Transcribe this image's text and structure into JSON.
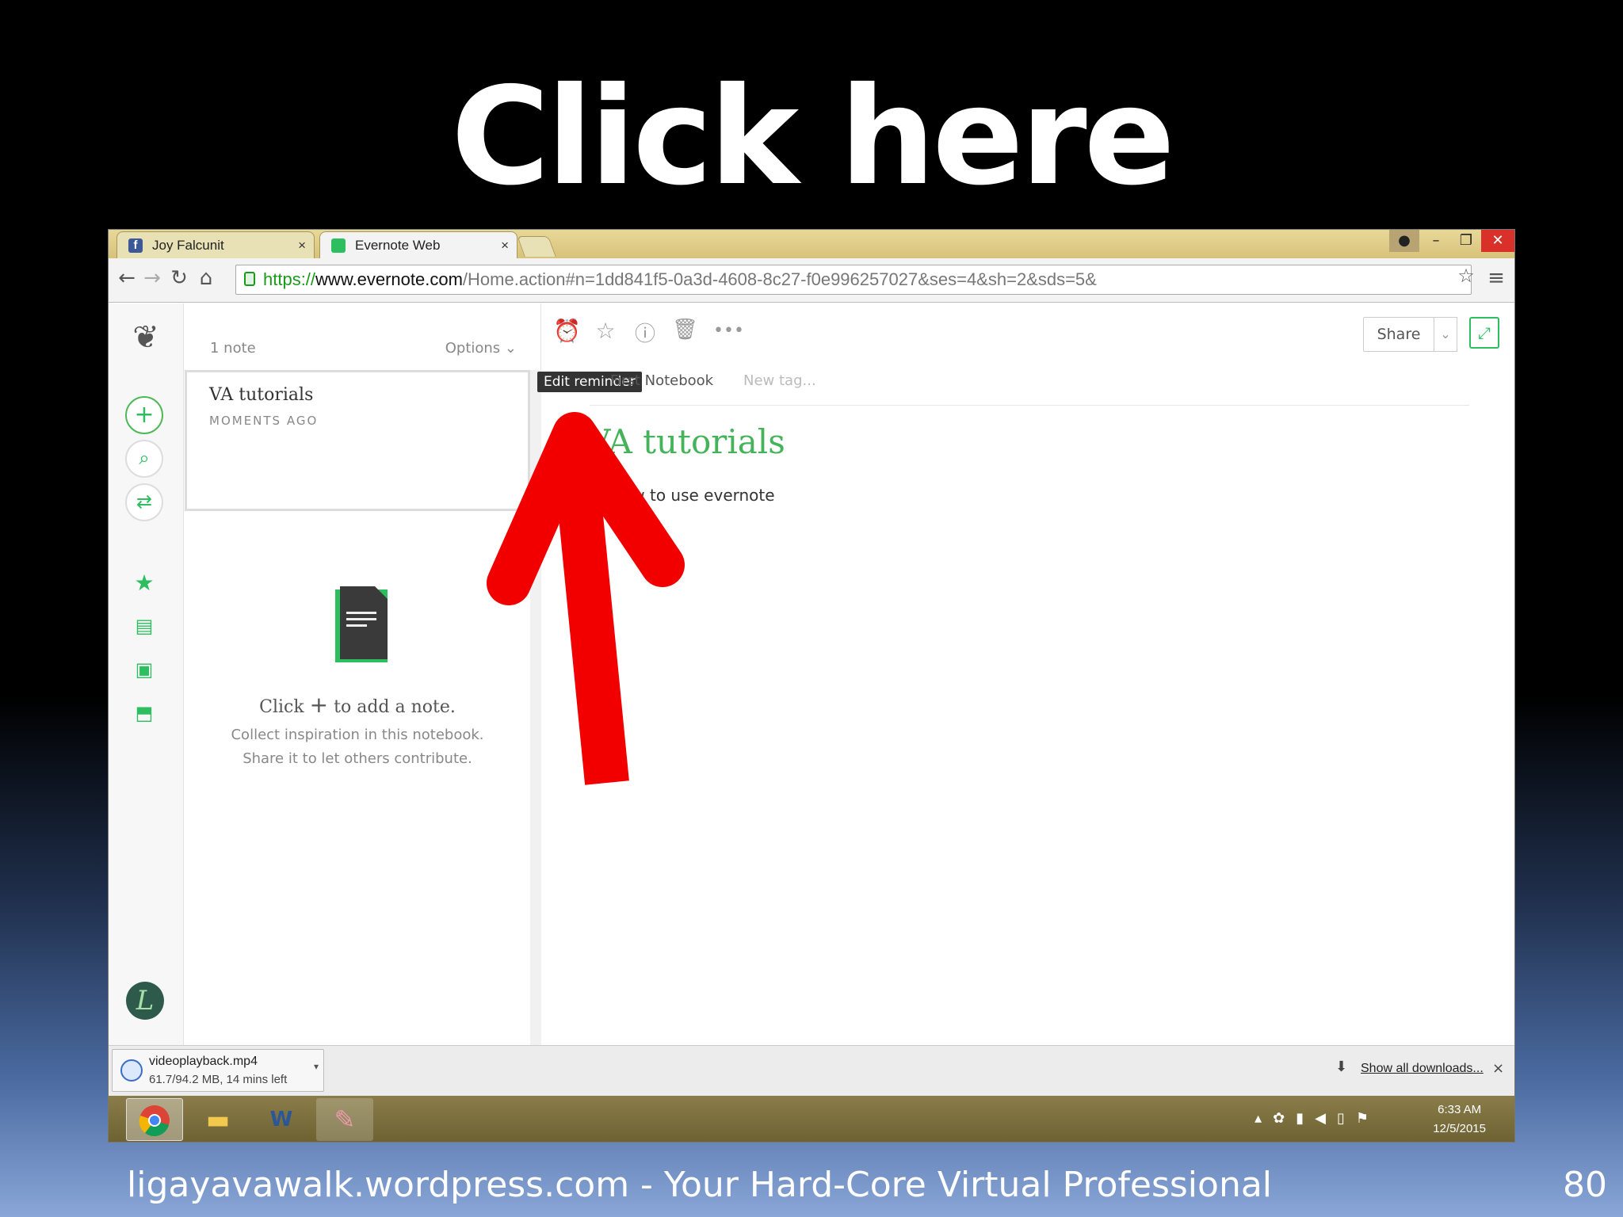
{
  "slide": {
    "title": "Click here",
    "footer": "ligayavawalk.wordpress.com - Your Hard-Core Virtual Professional",
    "page_number": "80"
  },
  "browser": {
    "tabs": [
      {
        "label": "Joy Falcunit",
        "favicon": "facebook-icon"
      },
      {
        "label": "Evernote Web",
        "favicon": "evernote-icon"
      }
    ],
    "url": {
      "scheme": "https://",
      "domain": "www.evernote.com",
      "path": "/Home.action#n=1dd841f5-0a3d-4608-8c27-f0e996257027&ses=4&sh=2&sds=5&"
    }
  },
  "note_list": {
    "count": "1 note",
    "options_label": "Options",
    "note": {
      "title": "VA tutorials",
      "time": "MOMENTS AGO"
    },
    "empty": {
      "click": "Click",
      "to_add": "to add a note.",
      "line1": "Collect inspiration in this notebook.",
      "line2": "Share it to let others contribute."
    }
  },
  "editor": {
    "tooltip": "Edit reminder",
    "notebook": "First Notebook",
    "new_tag": "New tag...",
    "share_label": "Share",
    "note_title": "VA tutorials",
    "note_body": "How to use evernote"
  },
  "downloads": {
    "file": "videoplayback.mp4",
    "progress": "61.7/94.2 MB, 14 mins left",
    "show_all": "Show all downloads..."
  },
  "taskbar": {
    "time": "6:33 AM",
    "date": "12/5/2015"
  },
  "colors": {
    "accent": "#2dbe60",
    "arrow": "#ff0000"
  }
}
